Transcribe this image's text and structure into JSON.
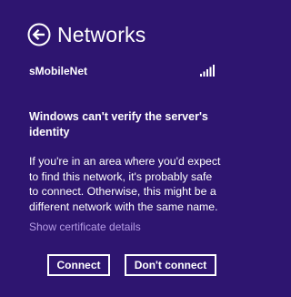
{
  "header": {
    "title": "Networks",
    "back_icon": "back-arrow-icon"
  },
  "network": {
    "name": "sMobileNet",
    "signal_icon": "signal-strength-icon",
    "signal_bars": 5
  },
  "warning": {
    "title": "Windows can't verify the server's identity",
    "body": "If you're in an area where you'd expect to find this network, it's probably safe to connect. Otherwise, this might be a different network with the same name."
  },
  "cert_link": "Show certificate details",
  "buttons": {
    "connect": "Connect",
    "dont_connect": "Don't connect"
  },
  "colors": {
    "background": "#2e1570",
    "text": "#ffffff",
    "link": "#b69de7"
  }
}
